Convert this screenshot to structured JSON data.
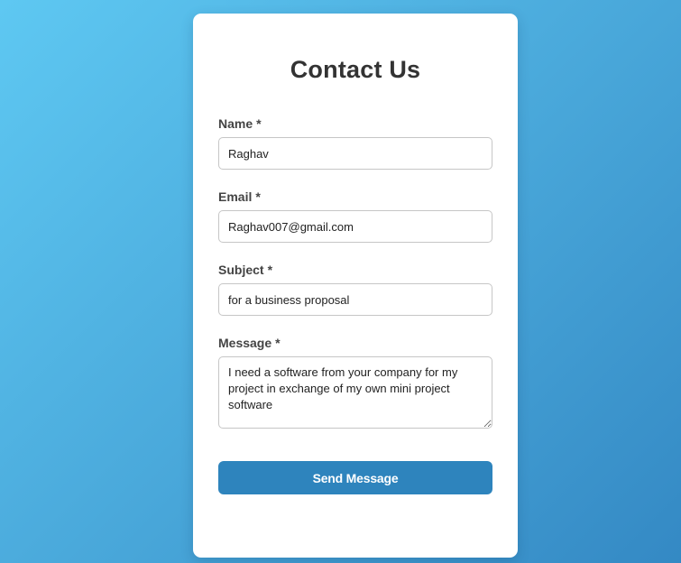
{
  "form": {
    "title": "Contact Us",
    "required_marker": "*",
    "fields": {
      "name": {
        "label": "Name",
        "value": "Raghav"
      },
      "email": {
        "label": "Email",
        "value": "Raghav007@gmail.com"
      },
      "subject": {
        "label": "Subject",
        "value": "for a business proposal"
      },
      "message": {
        "label": "Message",
        "value": "I need a software from your company for my project in exchange of my own mini project software"
      }
    },
    "submit_label": "Send Message"
  },
  "colors": {
    "background_gradient_start": "#5ec8f2",
    "background_gradient_end": "#3489c4",
    "card": "#ffffff",
    "button": "#2e84bd",
    "title_text": "#333333"
  }
}
